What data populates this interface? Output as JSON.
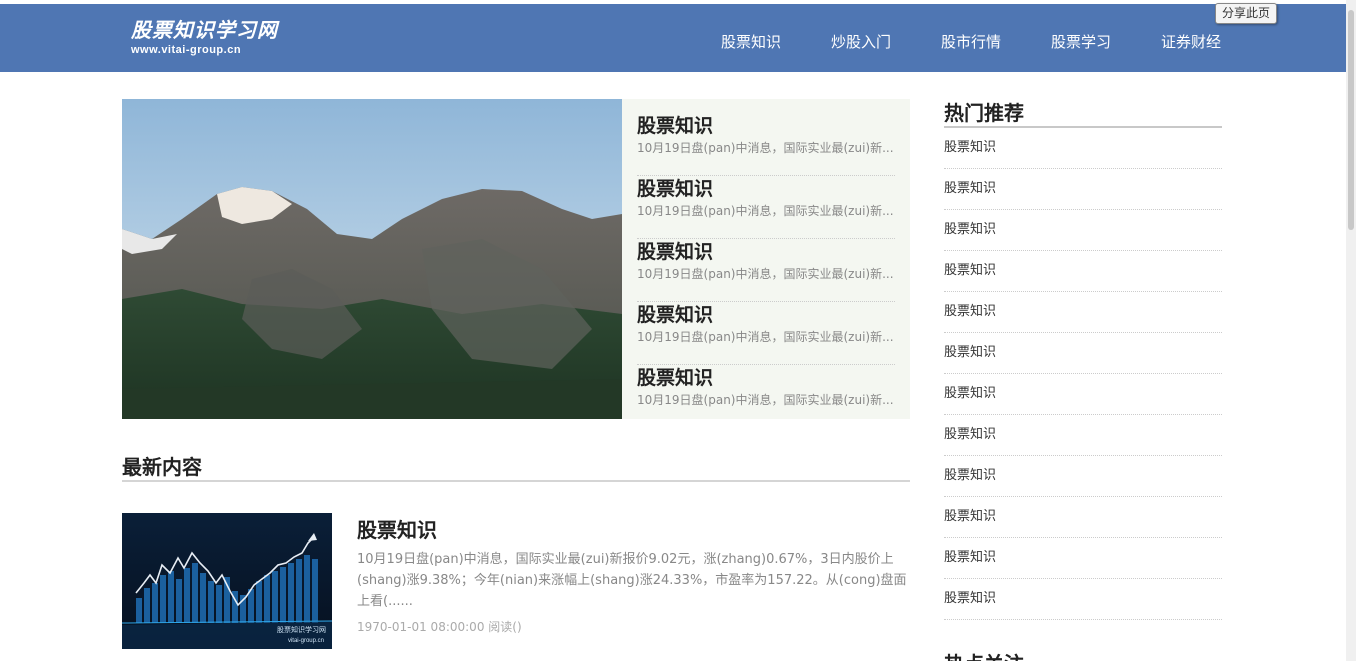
{
  "header": {
    "logo_name": "股票知识学习网",
    "logo_url": "www.vitai-group.cn",
    "nav": [
      "股票知识",
      "炒股入门",
      "股市行情",
      "股票学习",
      "证券财经"
    ],
    "share_label": "分享此页",
    "bg_color": "#4f76b3"
  },
  "hero": {
    "items": [
      {
        "title": "股票知识",
        "desc": "10月19日盘(pan)中消息，国际实业最(zui)新..."
      },
      {
        "title": "股票知识",
        "desc": "10月19日盘(pan)中消息，国际实业最(zui)新..."
      },
      {
        "title": "股票知识",
        "desc": "10月19日盘(pan)中消息，国际实业最(zui)新..."
      },
      {
        "title": "股票知识",
        "desc": "10月19日盘(pan)中消息，国际实业最(zui)新..."
      },
      {
        "title": "股票知识",
        "desc": "10月19日盘(pan)中消息，国际实业最(zui)新..."
      }
    ]
  },
  "latest": {
    "title": "最新内容",
    "article": {
      "title": "股票知识",
      "desc": "10月19日盘(pan)中消息，国际实业最(zui)新报价9.02元，涨(zhang)0.67%，3日内股价上(shang)涨9.38%；今年(nian)来涨幅上(shang)涨24.33%，市盈率为157.22。从(cong)盘面上看(......",
      "meta": "1970-01-01 08:00:00 阅读()",
      "thumb_caption": "股票知识学习网",
      "thumb_caption_url": "vitai-group.cn"
    }
  },
  "sidebar": {
    "hot_title": "热门推荐",
    "hot_items": [
      "股票知识",
      "股票知识",
      "股票知识",
      "股票知识",
      "股票知识",
      "股票知识",
      "股票知识",
      "股票知识",
      "股票知识",
      "股票知识",
      "股票知识",
      "股票知识"
    ],
    "focus_title": "热点关注"
  }
}
